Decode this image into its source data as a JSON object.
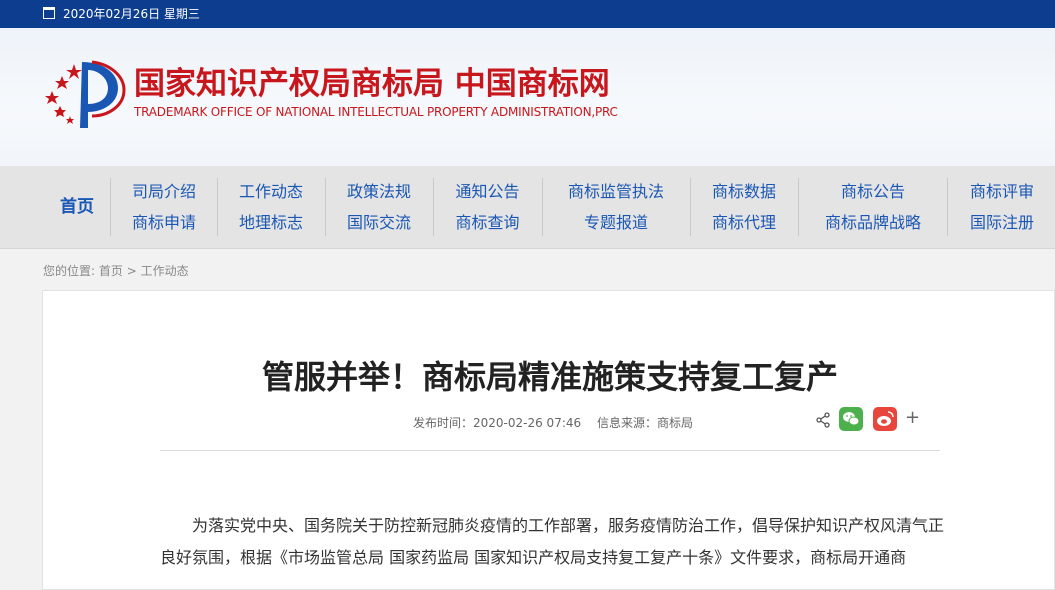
{
  "topbar": {
    "date": "2020年02月26日 星期三"
  },
  "header": {
    "site_cn": "国家知识产权局商标局 中国商标网",
    "site_en": "TRADEMARK OFFICE OF NATIONAL INTELLECTUAL PROPERTY ADMINISTRATION,PRC"
  },
  "nav": {
    "home": "首页",
    "columns": [
      [
        "司局介绍",
        "商标申请"
      ],
      [
        "工作动态",
        "地理标志"
      ],
      [
        "政策法规",
        "国际交流"
      ],
      [
        "通知公告",
        "商标查询"
      ],
      [
        "商标监管执法",
        "专题报道"
      ],
      [
        "商标数据",
        "商标代理"
      ],
      [
        "商标公告",
        "商标品牌战略"
      ],
      [
        "商标评审",
        "国际注册"
      ]
    ]
  },
  "breadcrumb": {
    "prefix": "您的位置:",
    "home": "首页",
    "sep": ">",
    "current": "工作动态"
  },
  "article": {
    "title": "管服并举！商标局精准施策支持复工复产",
    "publish_time": "发布时间：2020-02-26 07:46",
    "source": "信息来源：商标局",
    "paragraph": "为落实党中央、国务院关于防控新冠肺炎疫情的工作部署，服务疫情防治工作，倡导保护知识产权风清气正良好氛围，根据《市场监管总局 国家药监局 国家知识产权局支持复工复产十条》文件要求，商标局开通商"
  },
  "share": {
    "icons": [
      "share-icon",
      "wechat-icon",
      "weibo-icon",
      "plus-icon"
    ],
    "plus": "+"
  },
  "colors": {
    "topbar": "#0d3d8e",
    "brand_red": "#c8161d",
    "nav_text": "#1a57b5",
    "wechat": "#4cb14c",
    "weibo": "#e8453c"
  }
}
